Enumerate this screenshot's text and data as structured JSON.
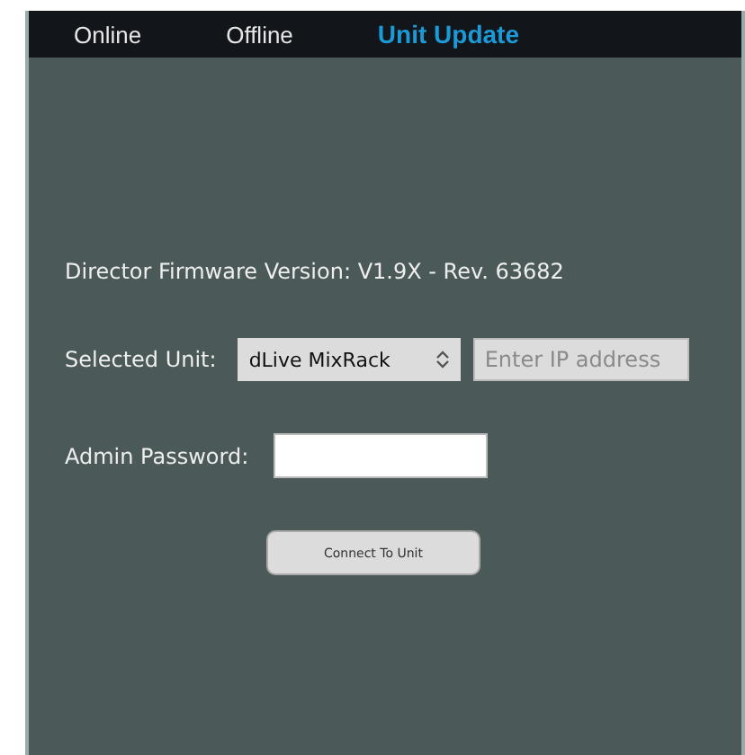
{
  "tabs": [
    {
      "label": "Online",
      "selected": false
    },
    {
      "label": "Offline",
      "selected": false
    },
    {
      "label": "Unit Update",
      "selected": true
    }
  ],
  "firmware_version": "Director Firmware Version: V1.9X - Rev. 63682",
  "selected_unit": {
    "label": "Selected Unit:",
    "value": "dLive MixRack",
    "ip_placeholder": "Enter IP address"
  },
  "admin_password": {
    "label": "Admin Password:"
  },
  "connect_button": "Connect To Unit"
}
